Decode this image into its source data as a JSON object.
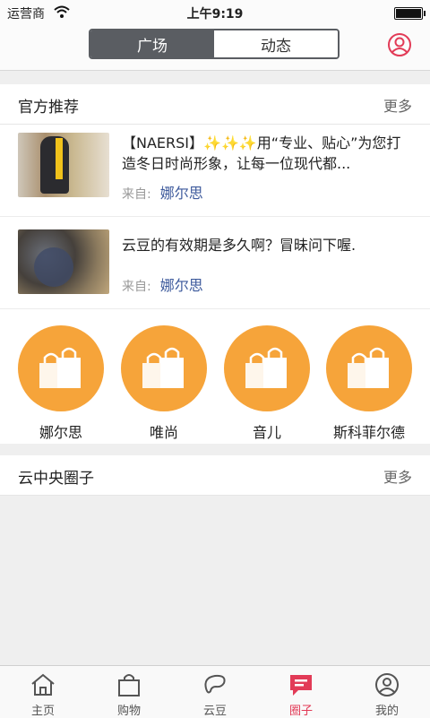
{
  "status_bar": {
    "carrier": "运营商",
    "time": "上午9:19",
    "battery_level": 1.0
  },
  "nav": {
    "segments": [
      {
        "label": "广场",
        "active": true
      },
      {
        "label": "动态",
        "active": false
      }
    ],
    "profile_icon": "person-circle-icon"
  },
  "official": {
    "title": "官方推荐",
    "more": "更多",
    "items": [
      {
        "text": "【NAERSI】✨✨✨用“专业、贴心”为您打造冬日时尚形象，让每一位现代都...",
        "source_label": "来自:",
        "source_name": "娜尔思"
      },
      {
        "text": "云豆的有效期是多久啊？冒昧问下喔.",
        "source_label": "来自:",
        "source_name": "娜尔思"
      }
    ],
    "brands": [
      {
        "name": "娜尔思",
        "icon": "shopping-bag-icon"
      },
      {
        "name": "唯尚",
        "icon": "shopping-bag-icon"
      },
      {
        "name": "音儿",
        "icon": "shopping-bag-icon"
      },
      {
        "name": "斯科菲尔德",
        "icon": "shopping-bag-icon"
      }
    ]
  },
  "cloud": {
    "title": "云中央圈子",
    "more": "更多"
  },
  "tabs": [
    {
      "label": "主页",
      "icon": "home-icon",
      "active": false
    },
    {
      "label": "购物",
      "icon": "shopping-bag-icon",
      "active": false
    },
    {
      "label": "云豆",
      "icon": "bean-icon",
      "active": false
    },
    {
      "label": "圈子",
      "icon": "chat-bubble-icon",
      "active": true
    },
    {
      "label": "我的",
      "icon": "person-circle-icon",
      "active": false
    }
  ],
  "colors": {
    "accent": "#e23b57",
    "brand_orange": "#f6a43a",
    "segment_dark": "#5a5d62",
    "link_blue": "#3d5a9c"
  }
}
